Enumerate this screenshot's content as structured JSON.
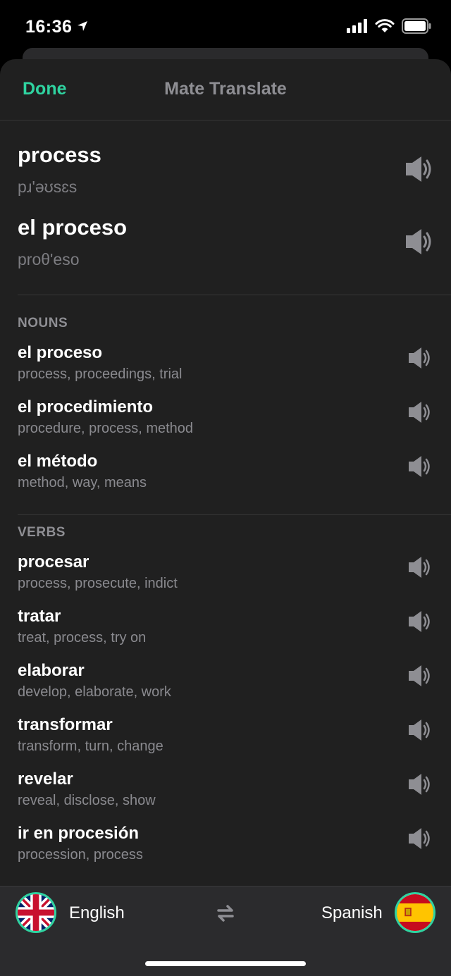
{
  "status": {
    "time": "16:36"
  },
  "header": {
    "done_label": "Done",
    "title": "Mate Translate"
  },
  "source": {
    "word": "process",
    "phonetic": "pɹ'əʊsɛs"
  },
  "target": {
    "word": "el proceso",
    "phonetic": "proθ'eso"
  },
  "sections": [
    {
      "title": "NOUNS",
      "items": [
        {
          "word": "el proceso",
          "translations": "process, proceedings, trial"
        },
        {
          "word": "el procedimiento",
          "translations": "procedure, process, method"
        },
        {
          "word": "el método",
          "translations": "method, way, means"
        }
      ]
    },
    {
      "title": "VERBS",
      "items": [
        {
          "word": "procesar",
          "translations": "process, prosecute, indict"
        },
        {
          "word": "tratar",
          "translations": "treat, process, try on"
        },
        {
          "word": "elaborar",
          "translations": "develop, elaborate, work"
        },
        {
          "word": "transformar",
          "translations": "transform, turn, change"
        },
        {
          "word": "revelar",
          "translations": "reveal, disclose, show"
        },
        {
          "word": "ir en procesión",
          "translations": "procession, process"
        }
      ]
    }
  ],
  "languages": {
    "from": "English",
    "to": "Spanish"
  },
  "colors": {
    "accent": "#2fd3a0",
    "background": "#202020"
  },
  "icons": {
    "speaker": "speaker-icon",
    "swap": "swap-arrows-icon",
    "from_flag": "uk-flag-icon",
    "to_flag": "spain-flag-icon"
  }
}
